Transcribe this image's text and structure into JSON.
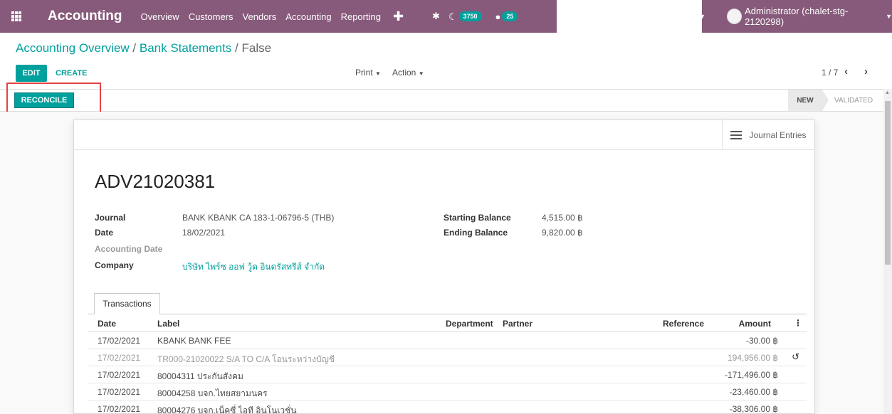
{
  "navbar": {
    "brand": "Accounting",
    "menu": [
      "Overview",
      "Customers",
      "Vendors",
      "Accounting",
      "Reporting"
    ],
    "activity_count": "3750",
    "message_count": "25",
    "user": "Administrator (chalet-stg-2120298)"
  },
  "breadcrumb": {
    "part1": "Accounting Overview",
    "sep1": " / ",
    "part2": "Bank Statements",
    "sep2": " / ",
    "current": "False"
  },
  "controls": {
    "edit": "EDIT",
    "create": "CREATE",
    "print": "Print",
    "action": "Action",
    "pager": "1 / 7"
  },
  "statusbar": {
    "reconcile": "RECONCILE",
    "stages": [
      "NEW",
      "VALIDATED"
    ]
  },
  "sheet": {
    "journal_entries": "Journal Entries",
    "title": "ADV21020381",
    "fields": {
      "journal_label": "Journal",
      "journal_value": "BANK KBANK CA 183-1-06796-5 (THB)",
      "date_label": "Date",
      "date_value": "18/02/2021",
      "accounting_date_label": "Accounting Date",
      "company_label": "Company",
      "company_value": "บริษัท ไพร์ซ ออฟ วู้ด อินดรัสทรีส์ จำกัด",
      "starting_balance_label": "Starting Balance",
      "starting_balance_value": "4,515.00 ฿",
      "ending_balance_label": "Ending Balance",
      "ending_balance_value": "9,820.00 ฿"
    },
    "tab": "Transactions",
    "table": {
      "headers": {
        "date": "Date",
        "label": "Label",
        "department": "Department",
        "partner": "Partner",
        "reference": "Reference",
        "amount": "Amount"
      },
      "rows": [
        {
          "date": "17/02/2021",
          "label": "KBANK BANK FEE",
          "amount": "-30.00 ฿"
        },
        {
          "date": "17/02/2021",
          "label": "TR000-21020022 S/A TO C/A โอนระหว่างบัญชี",
          "amount": "194,956.00 ฿"
        },
        {
          "date": "17/02/2021",
          "label": "80004311 ประกันสังคม",
          "amount": "-171,496.00 ฿"
        },
        {
          "date": "17/02/2021",
          "label": "80004258 บจก.ไทยสยามนคร",
          "amount": "-23,460.00 ฿"
        },
        {
          "date": "17/02/2021",
          "label": "80004276 บจก.เน็คซี่ ไอที อินโนเวชั่น",
          "amount": "-38,306.00 ฿"
        }
      ]
    }
  }
}
